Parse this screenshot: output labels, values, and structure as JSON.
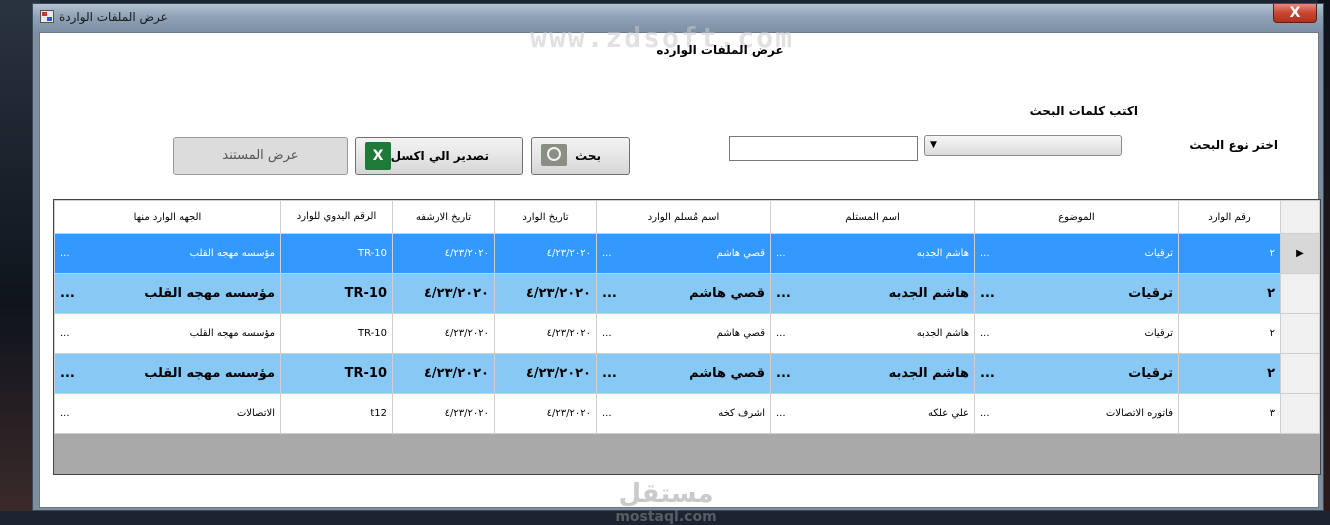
{
  "window": {
    "title": "عرض الملفات الواردة",
    "close_label": "X"
  },
  "form": {
    "heading": "عرض الملفات الوارده",
    "watermark_top": "www.zdsoft.com",
    "search_type_label": "اختر نوع البحث",
    "keywords_label": "اكتب كلمات البحث",
    "search_type_value": "",
    "keywords_value": ""
  },
  "buttons": {
    "search": "بحث",
    "export": "تصدير الي اكسل",
    "export_icon_text": "X",
    "show_document": "عرض المستند"
  },
  "grid": {
    "columns": [
      "رقم الوارد",
      "الموضوع",
      "اسم المستلم",
      "اسم مُسلم الوارد",
      "تاريخ الوارد",
      "تاريخ الارشفه",
      "الرقم اليدوي للوارد",
      "الجهه الوارد منها"
    ],
    "rows": [
      {
        "style": "sel",
        "marker": "▶",
        "cells": [
          "٢",
          "ترقيات",
          "هاشم الجدبه",
          "قصي هاشم",
          "٤/٢٣/٢٠٢٠",
          "٤/٢٣/٢٠٢٠",
          "TR-10",
          "مؤسسه مهجه القلب"
        ]
      },
      {
        "style": "bold",
        "marker": "",
        "cells": [
          "٢",
          "ترقيات",
          "هاشم الجدبه",
          "قصي هاشم",
          "٤/٢٣/٢٠٢٠",
          "٤/٢٣/٢٠٢٠",
          "TR-10",
          "مؤسسه مهجه القلب"
        ]
      },
      {
        "style": "plain",
        "marker": "",
        "cells": [
          "٢",
          "ترقيات",
          "هاشم الجدبه",
          "قصي هاشم",
          "٤/٢٣/٢٠٢٠",
          "٤/٢٣/٢٠٢٠",
          "TR-10",
          "مؤسسه مهجه القلب"
        ]
      },
      {
        "style": "bold",
        "marker": "",
        "cells": [
          "٢",
          "ترقيات",
          "هاشم الجدبه",
          "قصي هاشم",
          "٤/٢٣/٢٠٢٠",
          "٤/٢٣/٢٠٢٠",
          "TR-10",
          "مؤسسه مهجه القلب"
        ]
      },
      {
        "style": "plain",
        "marker": "",
        "cells": [
          "٣",
          "فاتوره الاتصالات",
          "علي علكه",
          "اشرف كخه",
          "٤/٢٣/٢٠٢٠",
          "٤/٢٣/٢٠٢٠",
          "t12",
          "الاتصالات"
        ]
      }
    ],
    "ellipsis": "..."
  },
  "watermark_bottom": {
    "arabic": "مستقل",
    "latin": "mostaql.com"
  },
  "colors": {
    "selected_row": "#3399ff",
    "highlight_row": "#87c8f5",
    "grid_background": "#a9a9a9"
  }
}
